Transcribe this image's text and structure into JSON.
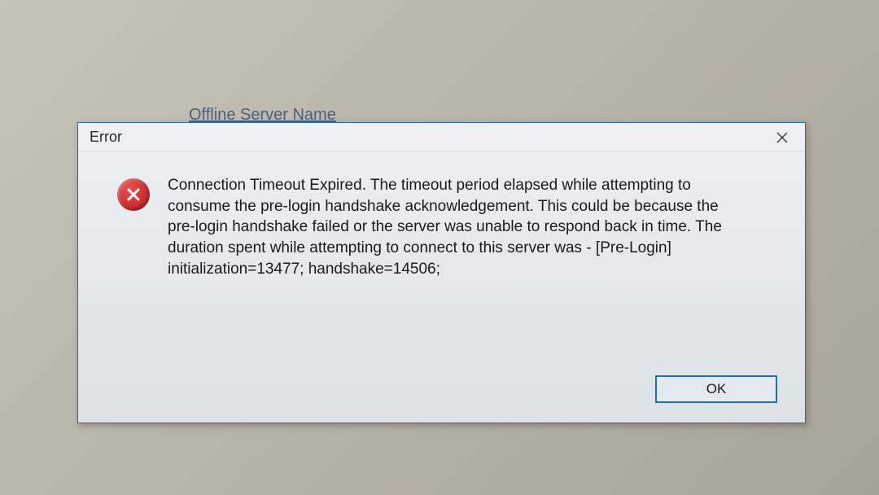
{
  "background": {
    "label": "Offline Server Name"
  },
  "dialog": {
    "title": "Error",
    "message": "Connection Timeout Expired.  The timeout period elapsed while attempting to consume the pre-login handshake acknowledgement.  This could be because the pre-login handshake failed or the server was unable to respond back in time.  The duration spent while attempting to connect to this server was - [Pre-Login] initialization=13477; handshake=14506;",
    "ok_label": "OK"
  }
}
